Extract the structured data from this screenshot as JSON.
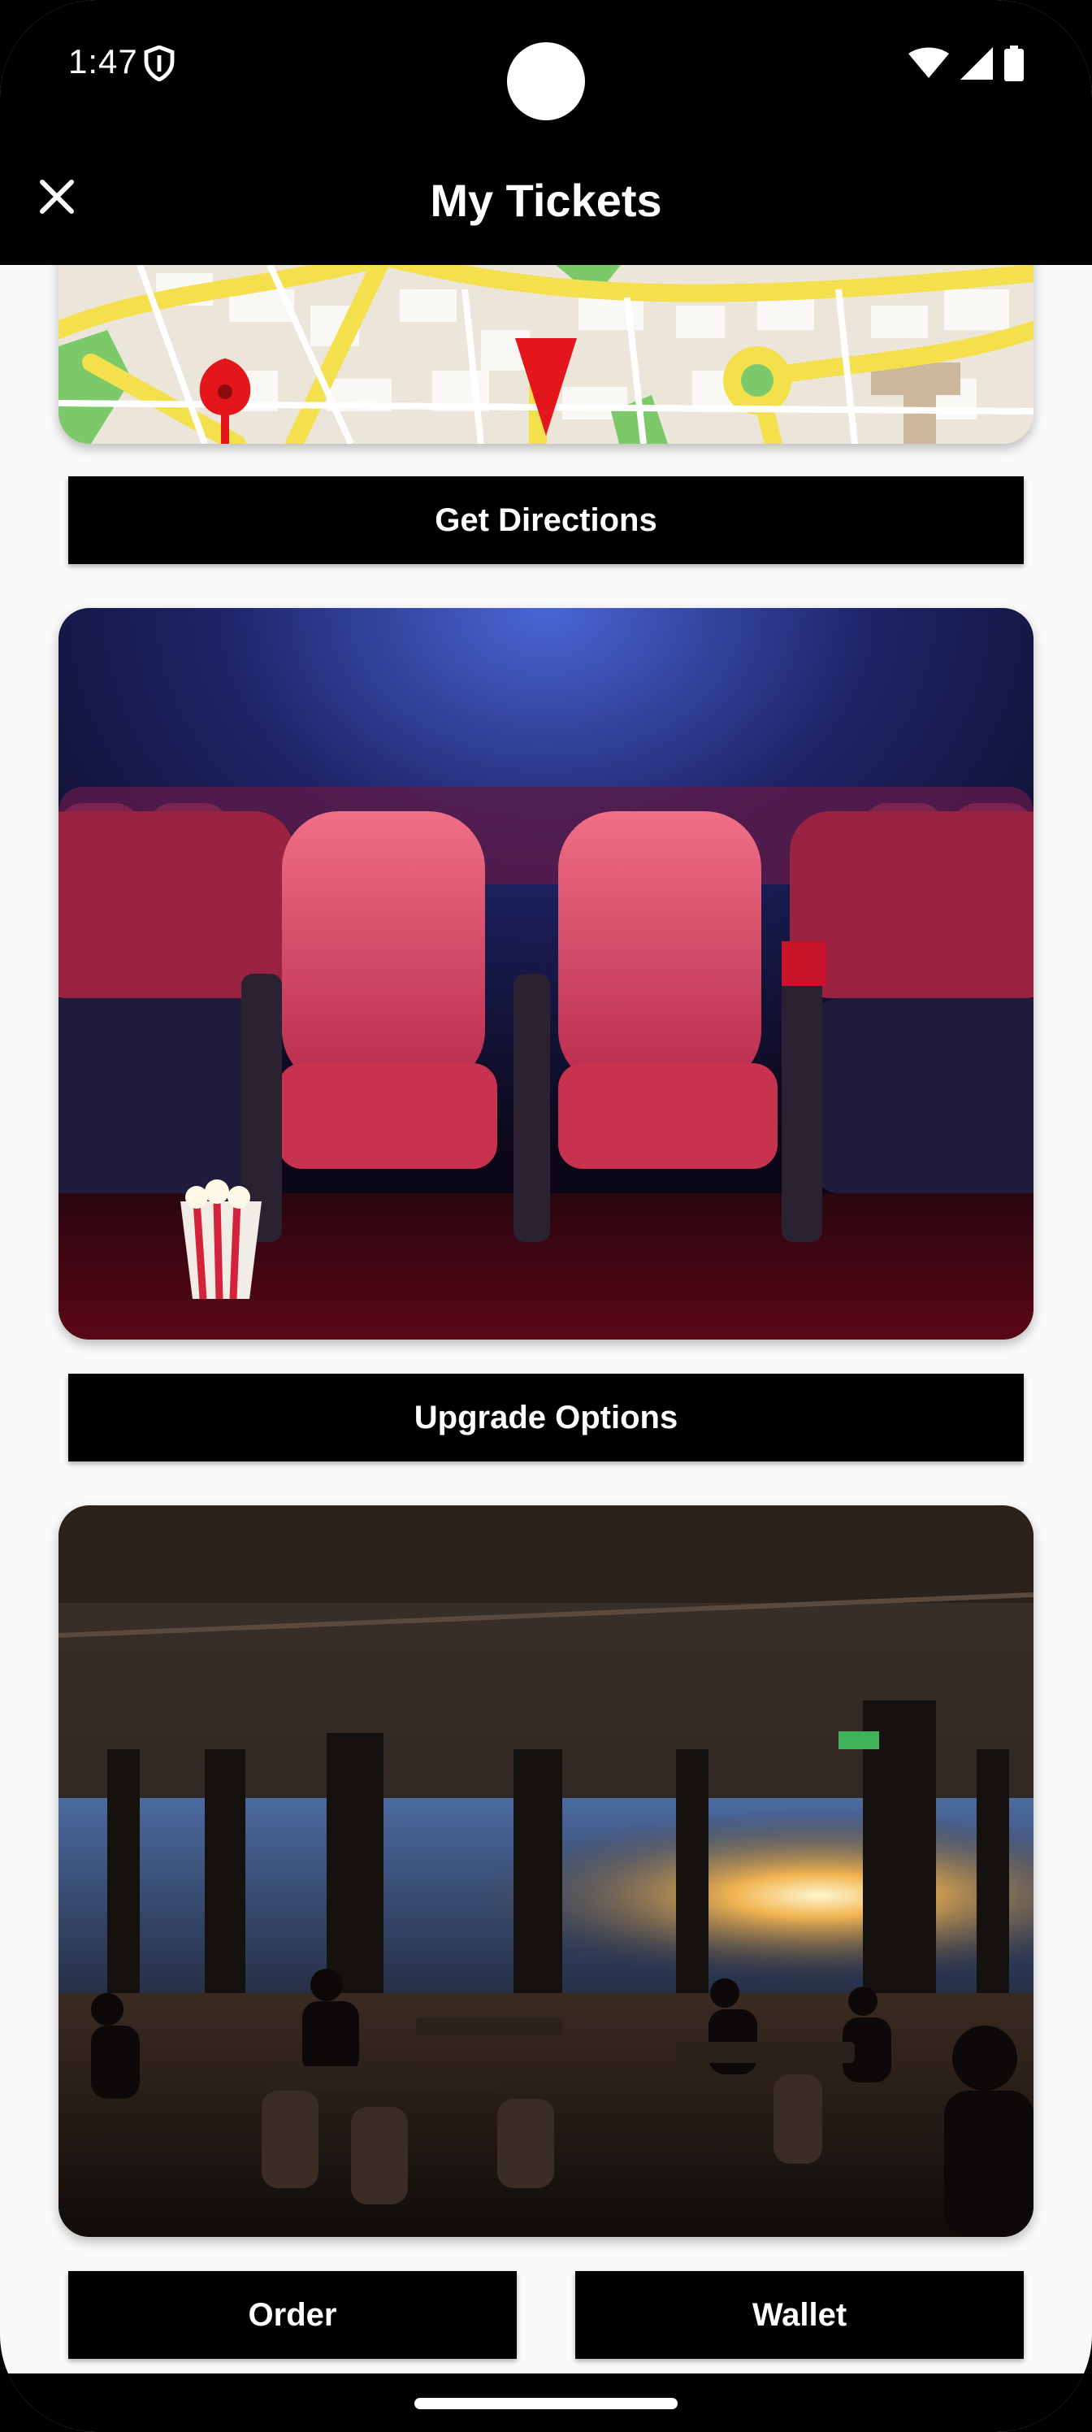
{
  "status_bar": {
    "time": "1:47",
    "icons": [
      "shield-icon",
      "wifi-icon",
      "cellular-signal-icon",
      "battery-icon"
    ]
  },
  "app_bar": {
    "title": "My Tickets",
    "close_icon": "close-icon"
  },
  "sections": {
    "map": {
      "image": "map-preview",
      "button_label": "Get Directions"
    },
    "theater": {
      "image": "cinema-seats-photo",
      "button_label": "Upgrade Options"
    },
    "restaurant": {
      "image": "rooftop-restaurant-photo",
      "buttons": [
        "Order",
        "Wallet"
      ]
    }
  },
  "colors": {
    "bar_background": "#000000",
    "page_background": "#fafafa",
    "button_background": "#000000",
    "button_text": "#ffffff"
  }
}
